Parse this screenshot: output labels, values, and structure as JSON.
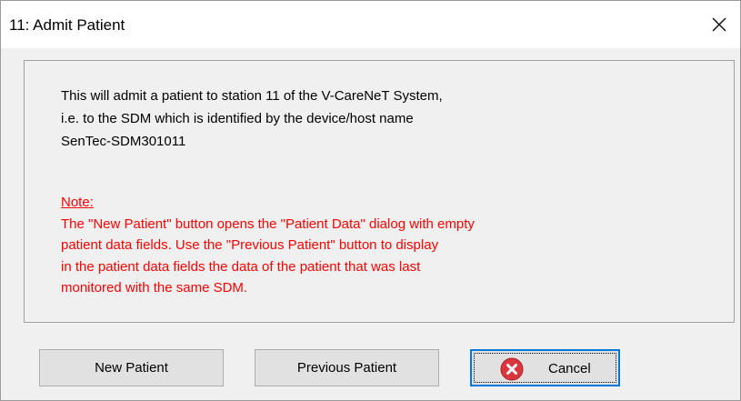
{
  "window": {
    "title": "11: Admit Patient",
    "close_icon": "close-icon"
  },
  "message": {
    "lines": [
      "This will admit a patient to station 11 of the V-CareNeT System,",
      "i.e. to the SDM which is identified by the device/host name",
      "SenTec-SDM301011"
    ]
  },
  "note": {
    "label": "Note:",
    "lines": [
      "The \"New Patient\" button opens the \"Patient Data\" dialog with empty",
      "patient data fields. Use the \"Previous Patient\" button to display",
      "in the patient data fields the data of the patient that was last",
      "monitored with the same SDM."
    ],
    "color": "#ff0000"
  },
  "buttons": {
    "new_patient": "New Patient",
    "previous_patient": "Previous Patient",
    "cancel": "Cancel",
    "cancel_icon": "error-circle-x-icon"
  },
  "colors": {
    "focus_border": "#0078d7",
    "cancel_icon": "#d9363e"
  }
}
